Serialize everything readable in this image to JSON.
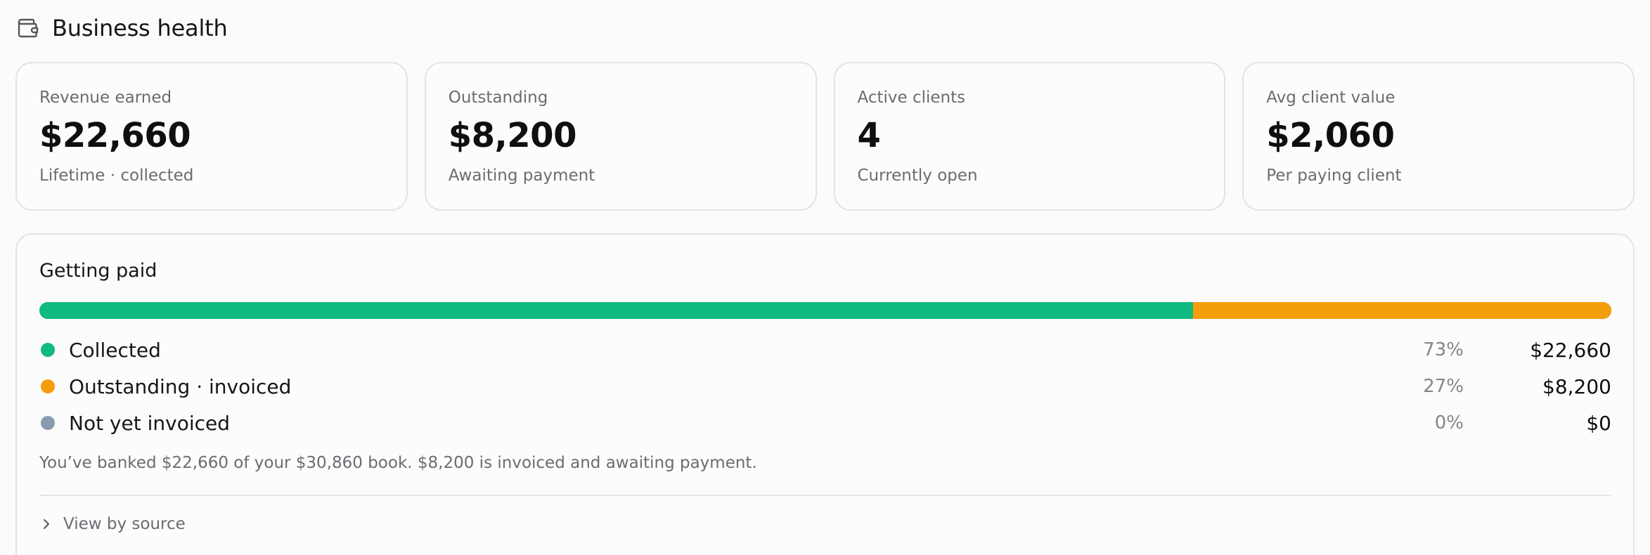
{
  "header": {
    "title": "Business health",
    "icon": "wallet-icon"
  },
  "cards": [
    {
      "label": "Revenue earned",
      "value": "$22,660",
      "sub": "Lifetime · collected"
    },
    {
      "label": "Outstanding",
      "value": "$8,200",
      "sub": "Awaiting payment"
    },
    {
      "label": "Active clients",
      "value": "4",
      "sub": "Currently open"
    },
    {
      "label": "Avg client value",
      "value": "$2,060",
      "sub": "Per paying client"
    }
  ],
  "getting_paid": {
    "title": "Getting paid",
    "segments": [
      {
        "label": "Collected",
        "pct": "73%",
        "amount": "$22,660",
        "fraction": 0.734,
        "color": "#10b981"
      },
      {
        "label": "Outstanding · invoiced",
        "pct": "27%",
        "amount": "$8,200",
        "fraction": 0.266,
        "color": "#f59e0b"
      },
      {
        "label": "Not yet invoiced",
        "pct": "0%",
        "amount": "$0",
        "fraction": 0,
        "color": "#8a9bb0"
      }
    ],
    "summary": "You’ve banked $22,660 of your $30,860 book. $8,200 is invoiced and awaiting payment.",
    "view_toggle_label": "View by source"
  }
}
